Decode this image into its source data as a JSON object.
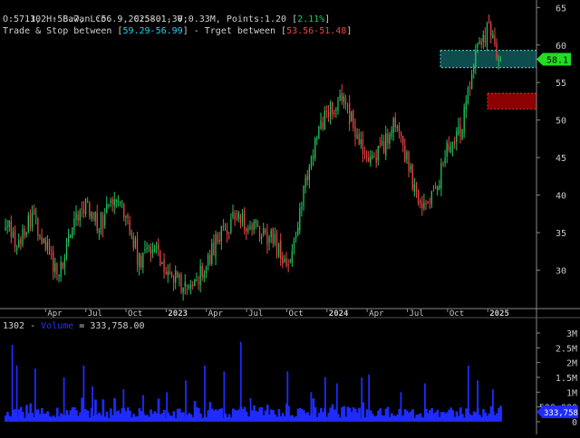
{
  "header": {
    "line1": "1302 - Bawan Co. - 2025-01-30,",
    "ohlc_text": "O:57.1, H:58.7, L:56.9, C:58.1, V:0.33M, Points:1.20 [",
    "change": "2.11%",
    "close_bracket": "]",
    "trade_prefix": "Trade & Stop between [",
    "trade_range": "59.29-56.99",
    "target_prefix": "] - Trget between [",
    "target_range": "53.56-51.48",
    "end_bracket": "]"
  },
  "volume_header": {
    "prefix": "1302 - ",
    "label": "Volume",
    "suffix": " = 333,758.00"
  },
  "colors": {
    "background": "#000000",
    "up": "#22c55e",
    "down": "#ef4444",
    "volume": "#1f2bff",
    "grid": "#2a2a2a",
    "axis_text": "#c8c8c8",
    "trade_zone": "#0e4d4d",
    "target_zone": "#8b0000",
    "price_tag": "#22dd22"
  },
  "chart_data": [
    {
      "type": "candlestick",
      "title": "1302 - Bawan Co. - 2025-01-30",
      "ylim": [
        25,
        66
      ],
      "y_ticks": [
        30,
        35,
        40,
        45,
        50,
        55,
        60,
        65
      ],
      "x_ticks": [
        "Apr",
        "Jul",
        "Oct",
        "2023",
        "Apr",
        "Jul",
        "Oct",
        "2024",
        "Apr",
        "Jul",
        "Oct",
        "2025"
      ],
      "x_range": [
        "2022-01",
        "2025-01"
      ],
      "last_price": 58.1,
      "last_price_label": "58.1",
      "trade_zone": [
        56.99,
        59.29
      ],
      "target_zone": [
        51.48,
        53.56
      ],
      "anchors": [
        [
          "2022-01",
          37.0
        ],
        [
          "2022-02",
          33.0
        ],
        [
          "2022-03",
          37.5
        ],
        [
          "2022-04",
          33.5
        ],
        [
          "2022-05",
          29.0
        ],
        [
          "2022-06",
          36.0
        ],
        [
          "2022-07",
          38.5
        ],
        [
          "2022-08",
          36.0
        ],
        [
          "2022-09",
          39.0
        ],
        [
          "2022-10",
          37.5
        ],
        [
          "2022-11",
          31.0
        ],
        [
          "2022-12",
          33.5
        ],
        [
          "2023-01",
          29.5
        ],
        [
          "2023-02",
          28.5
        ],
        [
          "2023-03",
          27.5
        ],
        [
          "2023-04",
          31.0
        ],
        [
          "2023-05",
          35.0
        ],
        [
          "2023-06",
          37.0
        ],
        [
          "2023-07",
          36.0
        ],
        [
          "2023-08",
          35.0
        ],
        [
          "2023-09",
          34.0
        ],
        [
          "2023-10",
          30.5
        ],
        [
          "2023-11",
          38.0
        ],
        [
          "2023-12",
          46.0
        ],
        [
          "2024-01",
          51.0
        ],
        [
          "2024-02",
          53.0
        ],
        [
          "2024-03",
          49.5
        ],
        [
          "2024-04",
          44.0
        ],
        [
          "2024-05",
          46.0
        ],
        [
          "2024-06",
          50.0
        ],
        [
          "2024-07",
          44.5
        ],
        [
          "2024-08",
          37.5
        ],
        [
          "2024-09",
          40.0
        ],
        [
          "2024-10",
          46.5
        ],
        [
          "2024-11",
          49.0
        ],
        [
          "2024-12",
          58.0
        ],
        [
          "2025-01",
          62.0
        ],
        [
          "2025-01-30",
          58.1
        ]
      ]
    },
    {
      "type": "bar",
      "series_label": "Volume",
      "last_value": 333758,
      "last_value_label": "333,758",
      "ylim": [
        0,
        3000000
      ],
      "y_ticks": [
        {
          "v": 0,
          "label": "0"
        },
        {
          "v": 500000,
          "label": "500,000"
        },
        {
          "v": 1000000,
          "label": "1M"
        },
        {
          "v": 1500000,
          "label": "1.5M"
        },
        {
          "v": 2000000,
          "label": "2M"
        },
        {
          "v": 2500000,
          "label": "2.5M"
        },
        {
          "v": 3000000,
          "label": "3M"
        }
      ],
      "spikes": [
        [
          "2022-01",
          1900000
        ],
        [
          "2022-01",
          2600000
        ],
        [
          "2022-03",
          1800000
        ],
        [
          "2022-05",
          1500000
        ],
        [
          "2022-06",
          1900000
        ],
        [
          "2022-07",
          1200000
        ],
        [
          "2022-09",
          1100000
        ],
        [
          "2022-11",
          900000
        ],
        [
          "2023-01",
          1000000
        ],
        [
          "2023-02",
          1400000
        ],
        [
          "2023-03",
          1900000
        ],
        [
          "2023-05",
          1700000
        ],
        [
          "2023-06",
          2700000
        ],
        [
          "2023-07",
          800000
        ],
        [
          "2023-10",
          1700000
        ],
        [
          "2023-11",
          1000000
        ],
        [
          "2023-12",
          1500000
        ],
        [
          "2024-01",
          1300000
        ],
        [
          "2024-03",
          1500000
        ],
        [
          "2024-04",
          1600000
        ],
        [
          "2024-06",
          1000000
        ],
        [
          "2024-08",
          1300000
        ],
        [
          "2024-11",
          1900000
        ],
        [
          "2024-12",
          1400000
        ],
        [
          "2025-01",
          1100000
        ]
      ]
    }
  ]
}
